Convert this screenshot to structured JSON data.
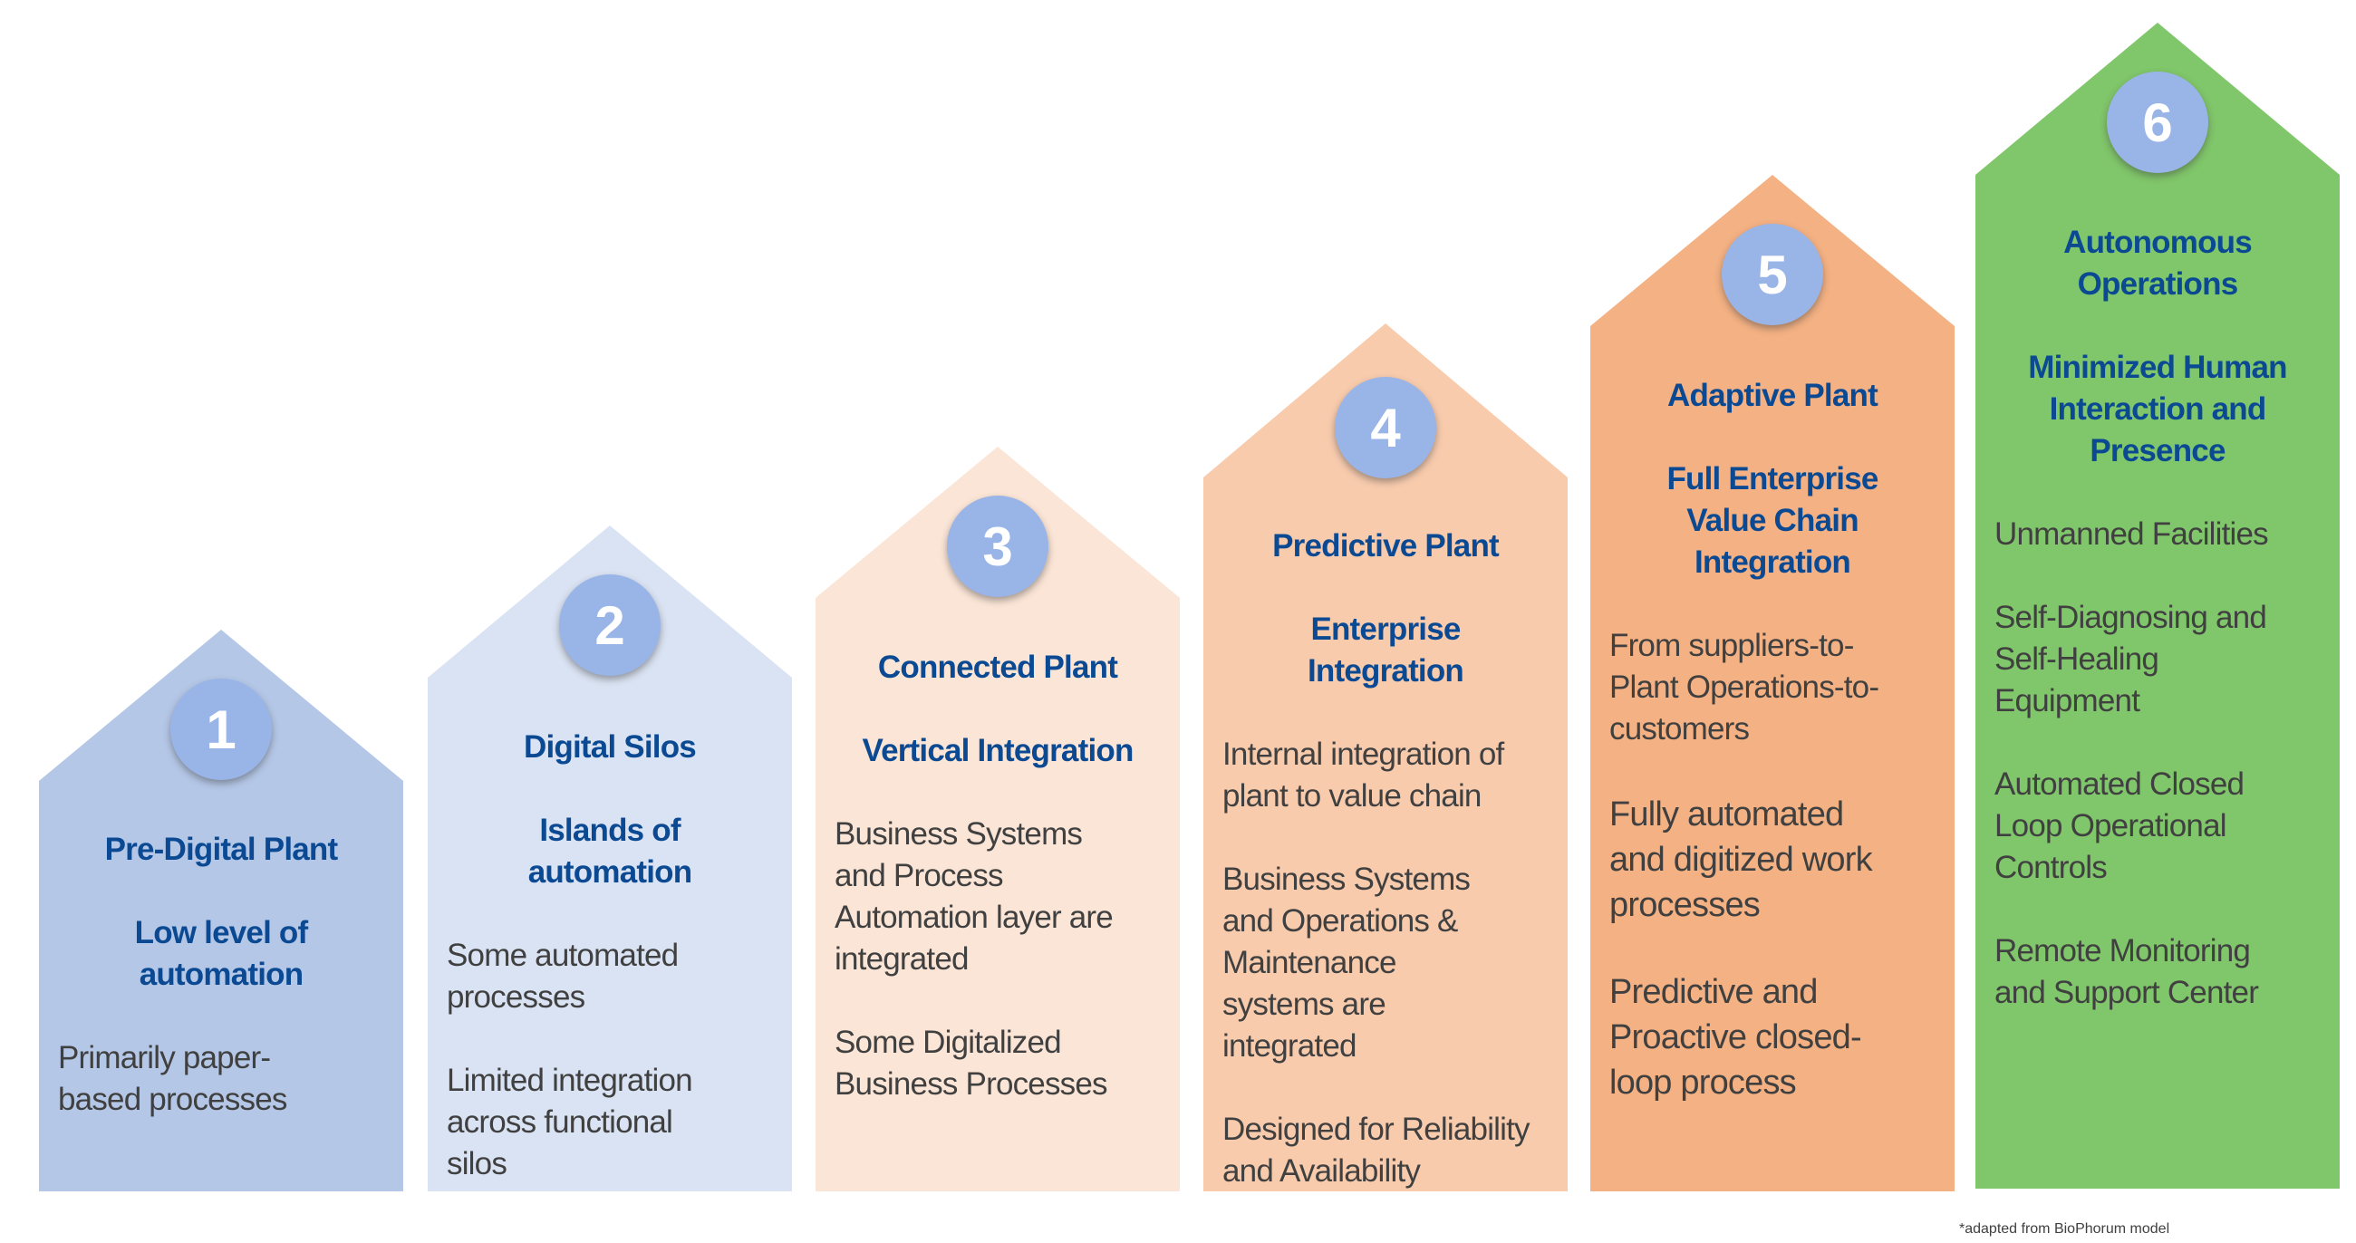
{
  "colors": {
    "title_text": "#0b4a92",
    "body_text": "#404040",
    "number_circle": "#99b5e8",
    "stage_1": "#b4c7e7",
    "stage_2": "#dae3f3",
    "stage_3": "#fbe5d6",
    "stage_4": "#f8cbad",
    "stage_5": "#f4b183",
    "stage_6": "#80c66a"
  },
  "stages": [
    {
      "number": "1",
      "color": "#b4c7e7",
      "paragraphs": [
        {
          "kind": "title",
          "lines": [
            "Pre-Digital Plant"
          ]
        },
        {
          "kind": "title",
          "lines": [
            "Low level of",
            "automation"
          ]
        },
        {
          "kind": "body",
          "lines": [
            "Primarily paper-",
            "based processes"
          ]
        }
      ]
    },
    {
      "number": "2",
      "color": "#dae3f3",
      "paragraphs": [
        {
          "kind": "title",
          "lines": [
            "Digital Silos"
          ]
        },
        {
          "kind": "title",
          "lines": [
            "Islands of",
            "automation"
          ]
        },
        {
          "kind": "body",
          "lines": [
            "Some automated",
            "processes"
          ]
        },
        {
          "kind": "body",
          "lines": [
            "Limited integration",
            "across functional",
            "silos"
          ]
        }
      ]
    },
    {
      "number": "3",
      "color": "#fbe5d6",
      "paragraphs": [
        {
          "kind": "title",
          "lines": [
            "Connected Plant"
          ]
        },
        {
          "kind": "title",
          "lines": [
            "Vertical Integration"
          ]
        },
        {
          "kind": "body",
          "lines": [
            "Business Systems",
            "and Process",
            "Automation layer are",
            "integrated"
          ]
        },
        {
          "kind": "body",
          "lines": [
            "Some Digitalized",
            "Business Processes"
          ]
        }
      ]
    },
    {
      "number": "4",
      "color": "#f8cbad",
      "paragraphs": [
        {
          "kind": "title",
          "lines": [
            "Predictive Plant"
          ]
        },
        {
          "kind": "title",
          "lines": [
            "Enterprise",
            "Integration"
          ]
        },
        {
          "kind": "body",
          "lines": [
            "Internal integration of",
            "plant to value chain"
          ]
        },
        {
          "kind": "body",
          "lines": [
            "Business Systems",
            "and Operations &",
            "Maintenance",
            "systems are",
            "integrated"
          ]
        },
        {
          "kind": "body",
          "lines": [
            "Designed for Reliability",
            "and Availability"
          ]
        }
      ]
    },
    {
      "number": "5",
      "color": "#f4b183",
      "paragraphs": [
        {
          "kind": "title",
          "lines": [
            "Adaptive Plant"
          ]
        },
        {
          "kind": "title",
          "lines": [
            "Full Enterprise",
            "Value Chain",
            "Integration"
          ]
        },
        {
          "kind": "body",
          "lines": [
            "From suppliers-to-",
            "Plant Operations-to-",
            "customers"
          ]
        },
        {
          "kind": "body big",
          "lines": [
            "Fully automated",
            "and digitized work",
            "processes"
          ]
        },
        {
          "kind": "body big",
          "lines": [
            "Predictive and",
            "Proactive closed-",
            "loop process"
          ]
        }
      ]
    },
    {
      "number": "6",
      "color": "#80c66a",
      "paragraphs": [
        {
          "kind": "title",
          "lines": [
            "Autonomous",
            "Operations"
          ]
        },
        {
          "kind": "title",
          "lines": [
            "Minimized Human",
            "Interaction and",
            "Presence"
          ]
        },
        {
          "kind": "body",
          "lines": [
            "Unmanned Facilities"
          ]
        },
        {
          "kind": "body",
          "lines": [
            "Self-Diagnosing and",
            "Self-Healing",
            "Equipment"
          ]
        },
        {
          "kind": "body",
          "lines": [
            "Automated Closed",
            "Loop Operational",
            "Controls"
          ]
        },
        {
          "kind": "body",
          "lines": [
            "Remote Monitoring",
            "and Support Center"
          ]
        }
      ]
    }
  ],
  "footnote": "*adapted from BioPhorum model"
}
